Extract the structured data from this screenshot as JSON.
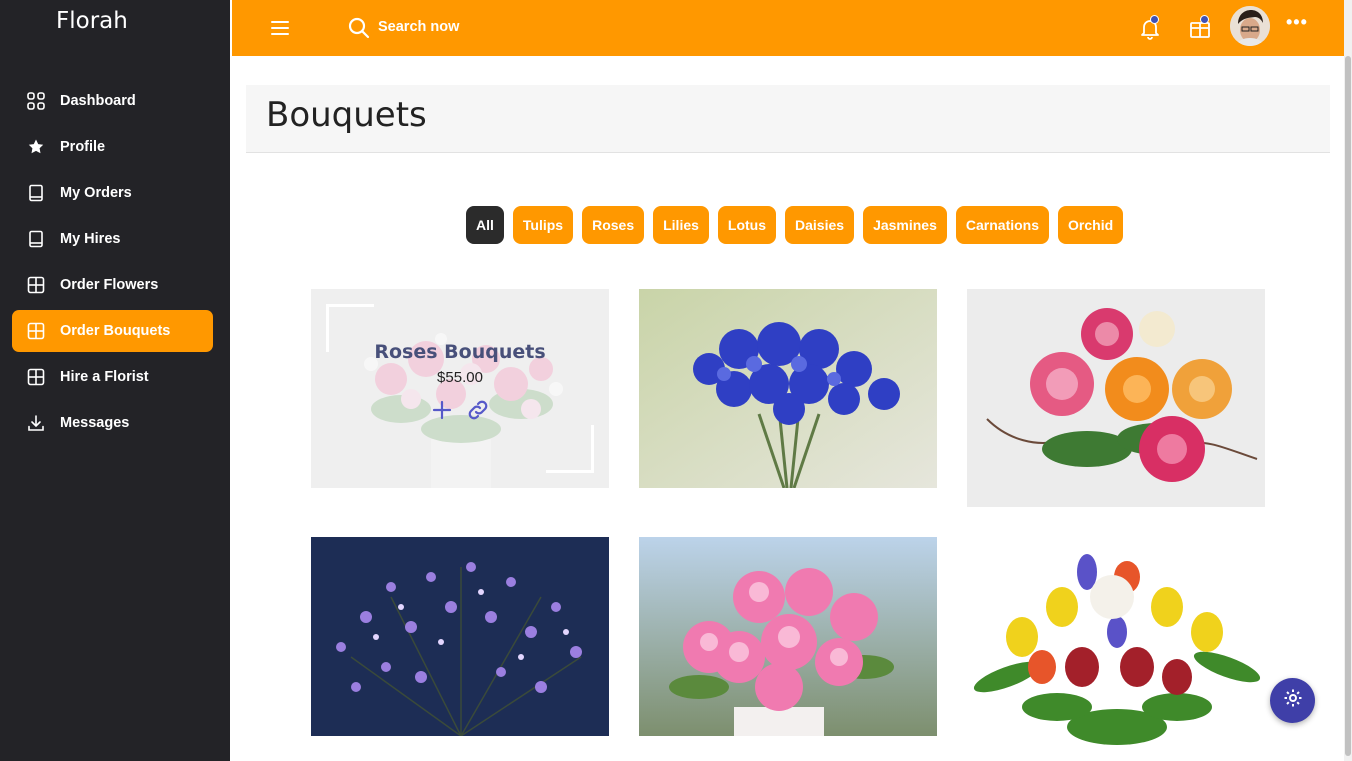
{
  "brand": "Florah",
  "sidebar": {
    "items": [
      {
        "label": "Dashboard",
        "icon": "grid-icon"
      },
      {
        "label": "Profile",
        "icon": "star-icon"
      },
      {
        "label": "My Orders",
        "icon": "book-icon"
      },
      {
        "label": "My Hires",
        "icon": "book-icon"
      },
      {
        "label": "Order Flowers",
        "icon": "table-icon"
      },
      {
        "label": "Order Bouquets",
        "icon": "table-icon",
        "active": true
      },
      {
        "label": "Hire a Florist",
        "icon": "table-icon"
      },
      {
        "label": "Messages",
        "icon": "download-icon"
      }
    ]
  },
  "topbar": {
    "search_placeholder": "Search now",
    "more_label": "•••"
  },
  "page": {
    "title": "Bouquets"
  },
  "filters": [
    "All",
    "Tulips",
    "Roses",
    "Lilies",
    "Lotus",
    "Daisies",
    "Jasmines",
    "Carnations",
    "Orchid"
  ],
  "active_filter": "All",
  "cards": [
    {
      "title": "Roses Bouquets",
      "price": "$55.00",
      "hovered": true
    },
    {
      "title": "",
      "price": ""
    },
    {
      "title": "",
      "price": ""
    },
    {
      "title": "",
      "price": ""
    },
    {
      "title": "",
      "price": ""
    },
    {
      "title": "",
      "price": ""
    }
  ],
  "colors": {
    "accent": "#ff9800",
    "sidebar_bg": "#232327",
    "active_chip": "#2b2b2b",
    "fab": "#3f3fa8",
    "overlay_title": "#48507a"
  }
}
